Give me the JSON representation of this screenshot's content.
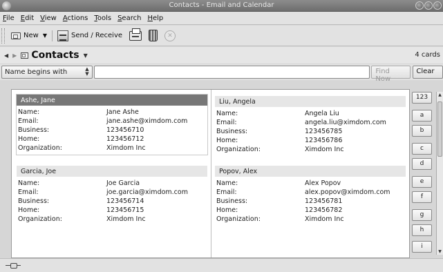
{
  "window": {
    "title": "Contacts - Email and Calendar"
  },
  "menubar": {
    "items": [
      {
        "mn": "F",
        "rest": "ile"
      },
      {
        "mn": "E",
        "rest": "dit"
      },
      {
        "mn": "V",
        "rest": "iew"
      },
      {
        "mn": "A",
        "rest": "ctions"
      },
      {
        "mn": "T",
        "rest": "ools"
      },
      {
        "mn": "S",
        "rest": "earch"
      },
      {
        "mn": "H",
        "rest": "elp"
      }
    ]
  },
  "toolbar": {
    "new_label": "New",
    "send_receive_label": "Send / Receive"
  },
  "nav": {
    "view_title": "Contacts",
    "card_count": "4 cards"
  },
  "search": {
    "mode": "Name begins with",
    "query": "",
    "find_label": "Find Now",
    "clear_label": "Clear"
  },
  "field_labels": {
    "name": "Name:",
    "email": "Email:",
    "business": "Business:",
    "home": "Home:",
    "organization": "Organization:"
  },
  "cards": [
    {
      "header": "Ashe, Jane",
      "name": "Jane Ashe",
      "email": "jane.ashe@ximdom.com",
      "business": "123456710",
      "home": "123456712",
      "organization": "Ximdom Inc",
      "selected": true
    },
    {
      "header": "Garcia, Joe",
      "name": "Joe Garcia",
      "email": "joe.garcia@ximdom.com",
      "business": "123456714",
      "home": "123456715",
      "organization": "Ximdom Inc",
      "selected": false
    },
    {
      "header": "Liu, Angela",
      "name": "Angela Liu",
      "email": "angela.liu@ximdom.com",
      "business": "123456785",
      "home": "123456786",
      "organization": "Ximdom Inc",
      "selected": false
    },
    {
      "header": "Popov, Alex",
      "name": "Alex Popov",
      "email": "alex.popov@ximdom.com",
      "business": "123456781",
      "home": "123456782",
      "organization": "Ximdom Inc",
      "selected": false
    }
  ],
  "alphabet": [
    "123",
    "a",
    "b",
    "c",
    "d",
    "e",
    "f",
    "g",
    "h",
    "i"
  ]
}
